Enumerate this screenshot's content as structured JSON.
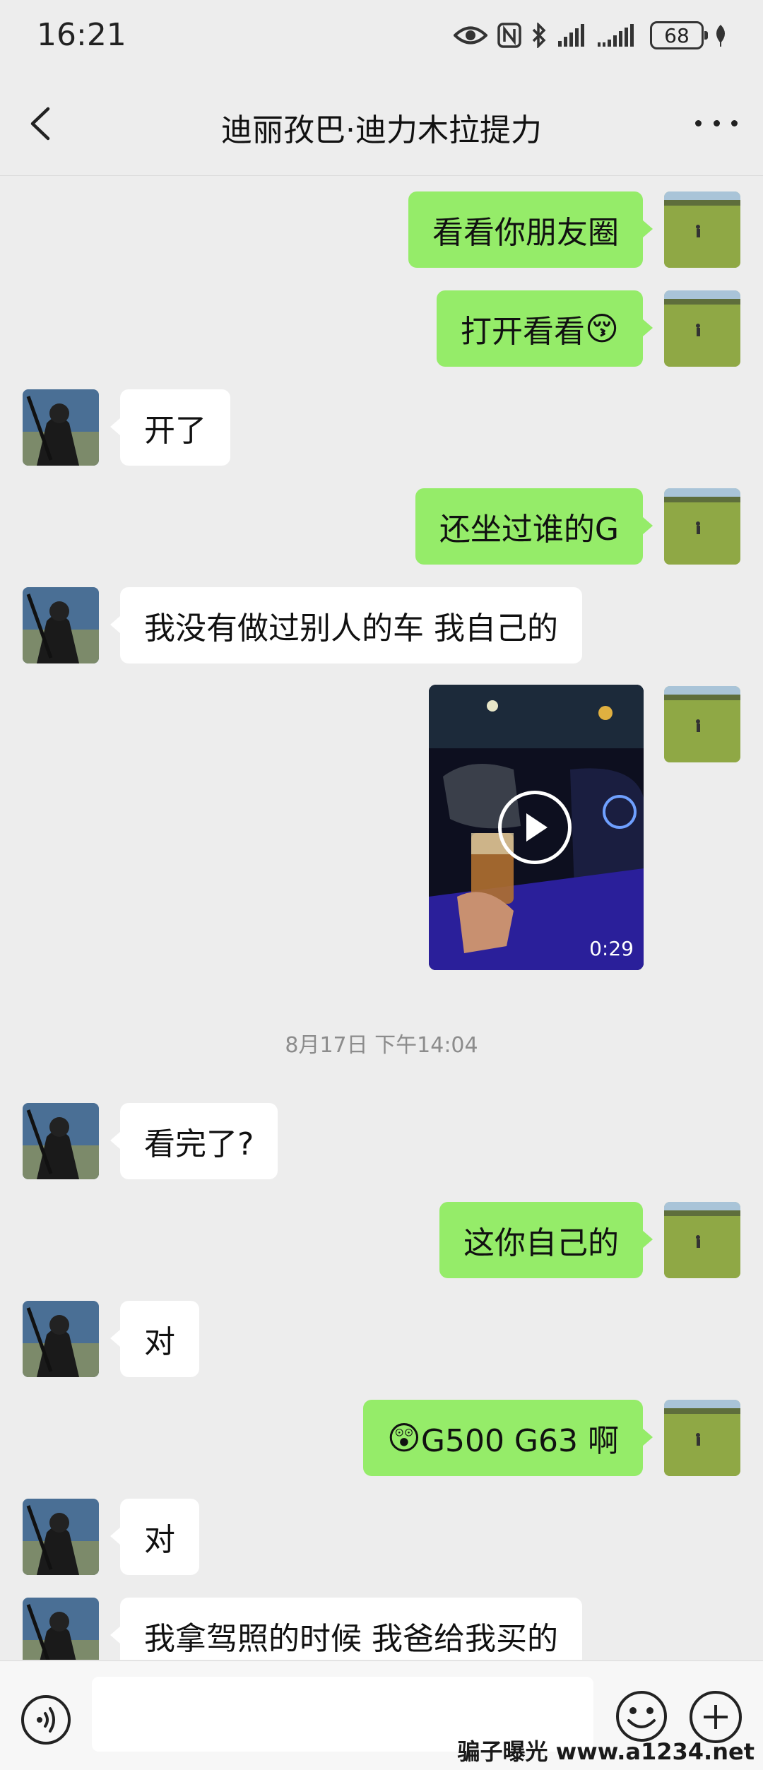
{
  "status_bar": {
    "time": "16:21",
    "battery": "68"
  },
  "header": {
    "title": "迪丽孜巴·迪力木拉提力"
  },
  "messages": [
    {
      "side": "right",
      "text": "看看你朋友圈"
    },
    {
      "side": "right",
      "text": "打开看看",
      "emoji": "😚"
    },
    {
      "side": "left",
      "text": "开了"
    },
    {
      "side": "right",
      "text": "还坐过谁的G"
    },
    {
      "side": "left",
      "text": "我没有做过别人的车  我自己的"
    },
    {
      "side": "right",
      "type": "video",
      "duration": "0:29"
    },
    {
      "side": "left",
      "text": "看完了?"
    },
    {
      "side": "right",
      "text": "这你自己的"
    },
    {
      "side": "left",
      "text": "对"
    },
    {
      "side": "right",
      "emoji": "😲",
      "text": "G500 G63 啊"
    },
    {
      "side": "left",
      "text": "对"
    },
    {
      "side": "left",
      "text": "我拿驾照的时候 我爸给我买的"
    }
  ],
  "timestamp": "8月17日 下午14:04",
  "watermark": "骗子曝光 www.a1234.net",
  "icons": [
    "back-arrow-icon",
    "more-icon",
    "voice-icon",
    "emoji-icon",
    "plus-icon",
    "play-icon"
  ],
  "colors": {
    "outgoing_bubble": "#95EC69",
    "incoming_bubble": "#FFFFFF",
    "background": "#EDEDED"
  }
}
